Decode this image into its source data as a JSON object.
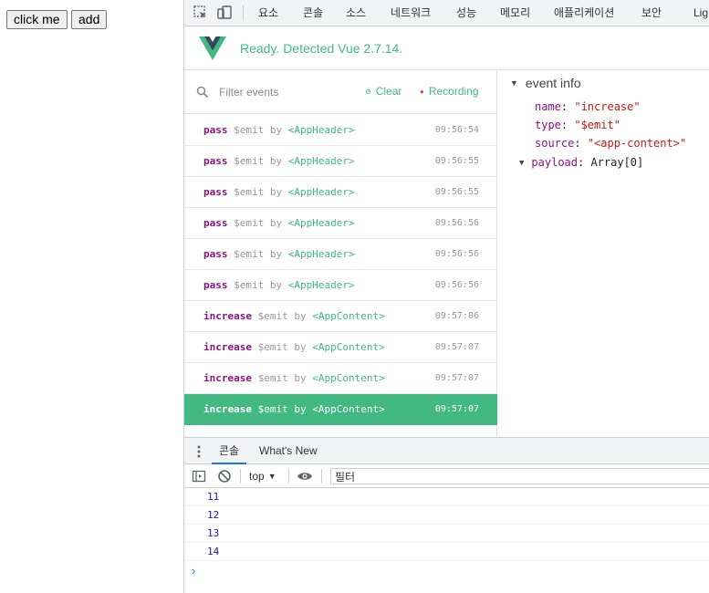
{
  "page": {
    "buttons": [
      "click me",
      "add"
    ]
  },
  "devtools": {
    "tabs": [
      "요소",
      "콘솔",
      "소스",
      "네트워크",
      "성능",
      "메모리",
      "애플리케이션",
      "보안",
      "Lig"
    ]
  },
  "vue": {
    "status": "Ready. Detected Vue 2.7.14.",
    "accent_color": "#42b983"
  },
  "events": {
    "filter_placeholder": "Filter events",
    "clear_label": "Clear",
    "recording_label": "Recording",
    "items": [
      {
        "name": "pass",
        "type": "$emit",
        "by": "by",
        "component": "<AppHeader>",
        "time": "09:56:54"
      },
      {
        "name": "pass",
        "type": "$emit",
        "by": "by",
        "component": "<AppHeader>",
        "time": "09:56:55"
      },
      {
        "name": "pass",
        "type": "$emit",
        "by": "by",
        "component": "<AppHeader>",
        "time": "09:56:55"
      },
      {
        "name": "pass",
        "type": "$emit",
        "by": "by",
        "component": "<AppHeader>",
        "time": "09:56:56"
      },
      {
        "name": "pass",
        "type": "$emit",
        "by": "by",
        "component": "<AppHeader>",
        "time": "09:56:56"
      },
      {
        "name": "pass",
        "type": "$emit",
        "by": "by",
        "component": "<AppHeader>",
        "time": "09:56:56"
      },
      {
        "name": "increase",
        "type": "$emit",
        "by": "by",
        "component": "<AppContent>",
        "time": "09:57:06"
      },
      {
        "name": "increase",
        "type": "$emit",
        "by": "by",
        "component": "<AppContent>",
        "time": "09:57:07"
      },
      {
        "name": "increase",
        "type": "$emit",
        "by": "by",
        "component": "<AppContent>",
        "time": "09:57:07"
      },
      {
        "name": "increase",
        "type": "$emit",
        "by": "by",
        "component": "<AppContent>",
        "time": "09:57:07"
      }
    ]
  },
  "event_info": {
    "title": "event info",
    "props": [
      {
        "key": "name",
        "value": "\"increase\""
      },
      {
        "key": "type",
        "value": "\"$emit\""
      },
      {
        "key": "source",
        "value": "\"<app-content>\""
      }
    ],
    "payload": {
      "key": "payload",
      "value": "Array[0]"
    }
  },
  "drawer": {
    "tabs": [
      "콘솔",
      "What's New"
    ],
    "context": "top",
    "filter_placeholder": "필터",
    "lines": [
      "11",
      "12",
      "13",
      "14"
    ],
    "prompt": "›"
  }
}
